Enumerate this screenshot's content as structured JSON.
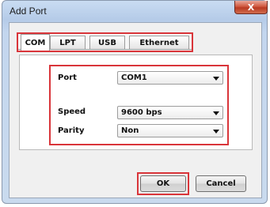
{
  "window": {
    "title": "Add Port",
    "close_label": "X"
  },
  "tabs": [
    {
      "label": "COM"
    },
    {
      "label": "LPT"
    },
    {
      "label": "USB"
    },
    {
      "label": "Ethernet"
    }
  ],
  "form": {
    "port": {
      "label": "Port",
      "value": "COM1"
    },
    "speed": {
      "label": "Speed",
      "value": "9600 bps"
    },
    "parity": {
      "label": "Parity",
      "value": "Non"
    }
  },
  "buttons": {
    "ok": "OK",
    "cancel": "Cancel"
  },
  "colors": {
    "highlight": "#d9353a",
    "title_bar": "#b5cbe8",
    "close_button": "#c94a30"
  }
}
